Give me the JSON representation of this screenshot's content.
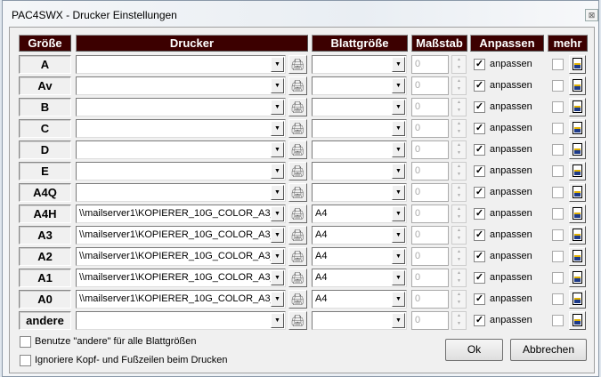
{
  "window": {
    "title": "PAC4SWX - Drucker Einstellungen",
    "close": "⊠"
  },
  "headers": {
    "size": "Größe",
    "printer": "Drucker",
    "paper": "Blattgröße",
    "scale": "Maßstab",
    "fit": "Anpassen",
    "more": "mehr"
  },
  "rows": [
    {
      "size": "A",
      "printer": "",
      "paper": "",
      "scale": "0",
      "fit": true,
      "fit_label": "anpassen",
      "more": false
    },
    {
      "size": "Av",
      "printer": "",
      "paper": "",
      "scale": "0",
      "fit": true,
      "fit_label": "anpassen",
      "more": false
    },
    {
      "size": "B",
      "printer": "",
      "paper": "",
      "scale": "0",
      "fit": true,
      "fit_label": "anpassen",
      "more": false
    },
    {
      "size": "C",
      "printer": "",
      "paper": "",
      "scale": "0",
      "fit": true,
      "fit_label": "anpassen",
      "more": false
    },
    {
      "size": "D",
      "printer": "",
      "paper": "",
      "scale": "0",
      "fit": true,
      "fit_label": "anpassen",
      "more": false
    },
    {
      "size": "E",
      "printer": "",
      "paper": "",
      "scale": "0",
      "fit": true,
      "fit_label": "anpassen",
      "more": false
    },
    {
      "size": "A4Q",
      "printer": "",
      "paper": "",
      "scale": "0",
      "fit": true,
      "fit_label": "anpassen",
      "more": false
    },
    {
      "size": "A4H",
      "printer": "\\\\mailserver1\\KOPIERER_10G_COLOR_A3_",
      "paper": "A4",
      "scale": "0",
      "fit": true,
      "fit_label": "anpassen",
      "more": false
    },
    {
      "size": "A3",
      "printer": "\\\\mailserver1\\KOPIERER_10G_COLOR_A3_",
      "paper": "A4",
      "scale": "0",
      "fit": true,
      "fit_label": "anpassen",
      "more": false
    },
    {
      "size": "A2",
      "printer": "\\\\mailserver1\\KOPIERER_10G_COLOR_A3_",
      "paper": "A4",
      "scale": "0",
      "fit": true,
      "fit_label": "anpassen",
      "more": false
    },
    {
      "size": "A1",
      "printer": "\\\\mailserver1\\KOPIERER_10G_COLOR_A3_",
      "paper": "A4",
      "scale": "0",
      "fit": true,
      "fit_label": "anpassen",
      "more": false
    },
    {
      "size": "A0",
      "printer": "\\\\mailserver1\\KOPIERER_10G_COLOR_A3_",
      "paper": "A4",
      "scale": "0",
      "fit": true,
      "fit_label": "anpassen",
      "more": false
    },
    {
      "size": "andere",
      "printer": "",
      "paper": "",
      "scale": "0",
      "fit": true,
      "fit_label": "anpassen",
      "more": false
    }
  ],
  "options": [
    {
      "label": "Benutze \"andere\" für alle Blattgrößen",
      "checked": false
    },
    {
      "label": "Ignoriere Kopf- und Fußzeilen beim Drucken",
      "checked": false
    }
  ],
  "buttons": {
    "ok": "Ok",
    "cancel": "Abbrechen"
  }
}
